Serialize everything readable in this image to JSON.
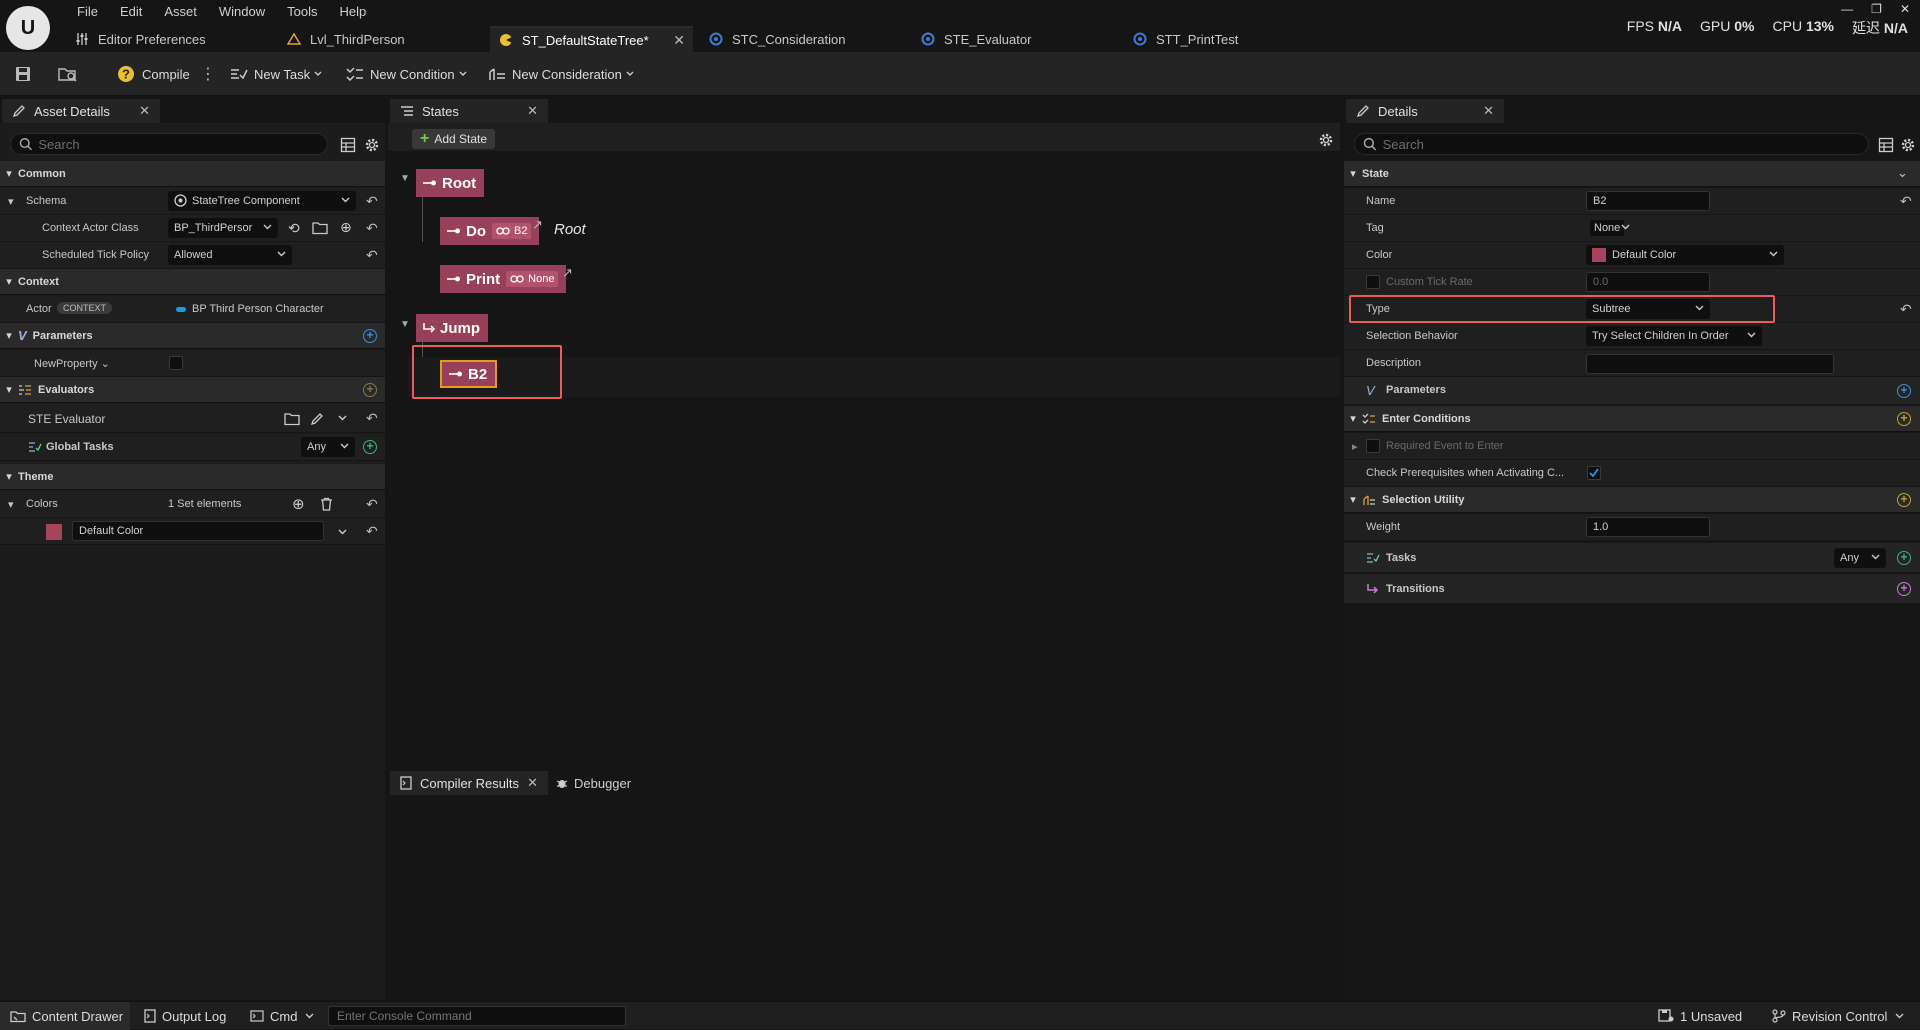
{
  "menu": [
    "File",
    "Edit",
    "Asset",
    "Window",
    "Tools",
    "Help"
  ],
  "tabs": [
    {
      "label": "Editor Preferences",
      "icon": "sliders-icon"
    },
    {
      "label": "Lvl_ThirdPerson",
      "icon": "level-icon"
    },
    {
      "label": "ST_DefaultStateTree*",
      "icon": "statetree-icon"
    },
    {
      "label": "STC_Consideration",
      "icon": "blueprint-icon"
    },
    {
      "label": "STE_Evaluator",
      "icon": "blueprint-icon"
    },
    {
      "label": "STT_PrintTest",
      "icon": "blueprint-icon"
    }
  ],
  "stats": {
    "fps_label": "FPS",
    "fps": "N/A",
    "gpu_label": "GPU",
    "gpu": "0%",
    "cpu_label": "CPU",
    "cpu": "13%",
    "lat_label": "延迟",
    "lat": "N/A"
  },
  "toolbar": {
    "compile": "Compile",
    "new_task": "New Task",
    "new_condition": "New Condition",
    "new_consideration": "New Consideration"
  },
  "asset_details": {
    "tab": "Asset Details",
    "search_placeholder": "Search",
    "common": "Common",
    "schema_label": "Schema",
    "schema_value": "StateTree Component",
    "context_actor_label": "Context Actor Class",
    "context_actor_value": "BP_ThirdPersor",
    "tick_policy_label": "Scheduled Tick Policy",
    "tick_policy_value": "Allowed",
    "context": "Context",
    "actor_label": "Actor",
    "actor_badge": "CONTEXT",
    "actor_value": "BP Third Person Character",
    "parameters": "Parameters",
    "new_property": "NewProperty",
    "evaluators": "Evaluators",
    "ste_evaluator": "STE Evaluator",
    "global_tasks": "Global Tasks",
    "global_tasks_any": "Any",
    "theme": "Theme",
    "colors_label": "Colors",
    "colors_value": "1 Set elements",
    "default_color": "Default Color",
    "color_swatch": "#a8435e"
  },
  "states": {
    "tab": "States",
    "add_state": "Add State",
    "root": "Root",
    "do": "Do",
    "do_link": "B2",
    "do_target": "Root",
    "print": "Print",
    "print_link": "None",
    "jump": "Jump",
    "b2": "B2"
  },
  "bottom_panel": {
    "compiler_results": "Compiler Results",
    "debugger": "Debugger"
  },
  "details": {
    "tab": "Details",
    "search_placeholder": "Search",
    "state": "State",
    "name_label": "Name",
    "name_value": "B2",
    "tag_label": "Tag",
    "tag_value": "None",
    "color_label": "Color",
    "color_value": "Default Color",
    "custom_tick_label": "Custom Tick Rate",
    "custom_tick_value": "0.0",
    "type_label": "Type",
    "type_value": "Subtree",
    "selection_behavior_label": "Selection Behavior",
    "selection_behavior_value": "Try Select Children In Order",
    "description_label": "Description",
    "parameters": "Parameters",
    "enter_conditions": "Enter Conditions",
    "required_event": "Required Event to Enter",
    "check_prereq": "Check Prerequisites when Activating C...",
    "selection_utility": "Selection Utility",
    "weight_label": "Weight",
    "weight_value": "1.0",
    "tasks": "Tasks",
    "tasks_any": "Any",
    "transitions": "Transitions"
  },
  "statusbar": {
    "content_drawer": "Content Drawer",
    "output_log": "Output Log",
    "cmd": "Cmd",
    "console_placeholder": "Enter Console Command",
    "unsaved": "1 Unsaved",
    "revision_control": "Revision Control"
  }
}
